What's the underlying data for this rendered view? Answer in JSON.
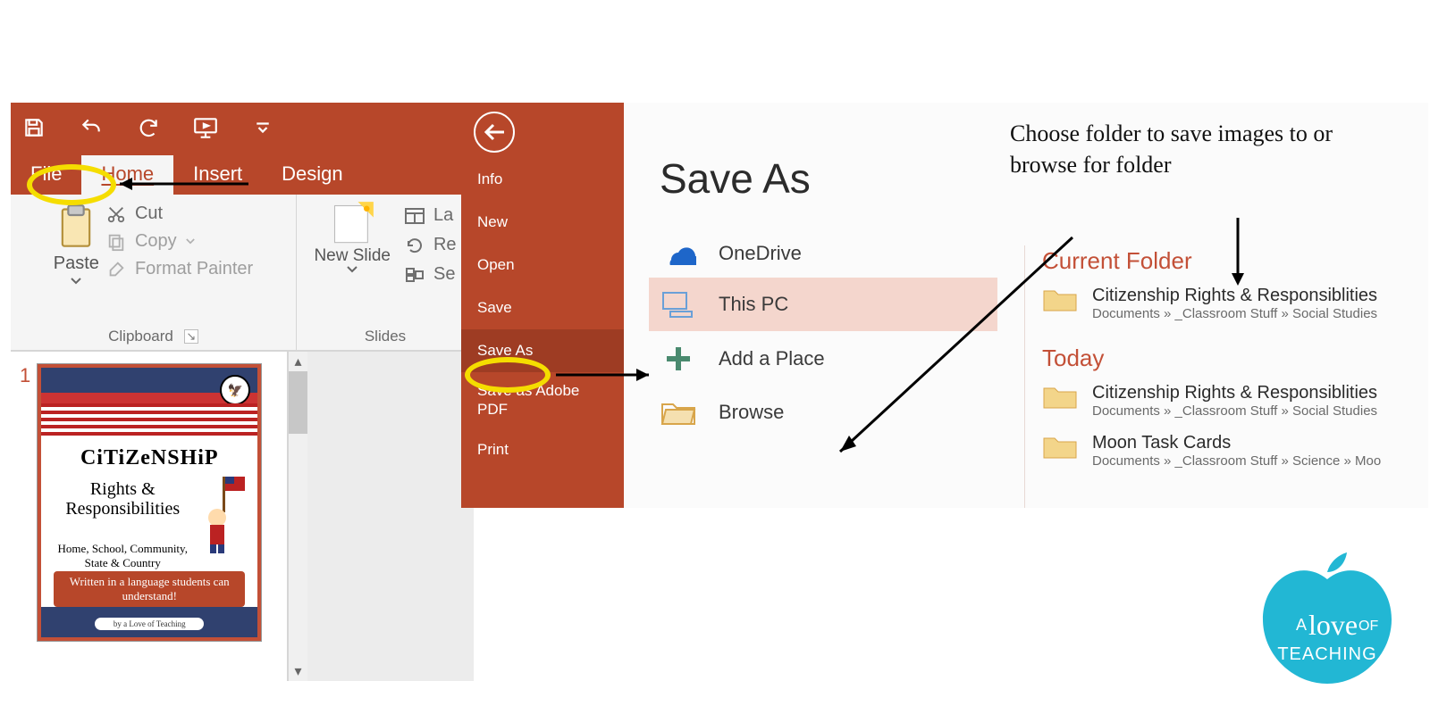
{
  "quick_access": {
    "save_tooltip": "Save",
    "undo_tooltip": "Undo",
    "redo_tooltip": "Redo",
    "start_show_tooltip": "Start From Beginning",
    "customize_tooltip": "Customize"
  },
  "tabs": {
    "file": "File",
    "home": "Home",
    "insert": "Insert",
    "design": "Design"
  },
  "ribbon": {
    "clipboard": {
      "paste": "Paste",
      "cut": "Cut",
      "copy": "Copy",
      "format_painter": "Format Painter",
      "group_label": "Clipboard"
    },
    "slides": {
      "new_slide": "New Slide",
      "layout_trunc": "La",
      "reset_trunc": "Re",
      "section_trunc": "Se",
      "group_label": "Slides"
    }
  },
  "slide_thumb": {
    "number": "1",
    "title": "CiTiZeNSHiP",
    "subtitle": "Rights & Responsibilities",
    "scope": "Home, School, Community, State & Country",
    "blurb": "Written in a language students can understand!",
    "credit": "by a Love of Teaching"
  },
  "backstage": {
    "info": "Info",
    "new": "New",
    "open": "Open",
    "save": "Save",
    "save_as": "Save As",
    "save_adobe": "Save as Adobe PDF",
    "print": "Print"
  },
  "saveas": {
    "heading": "Save As",
    "locations": {
      "onedrive": "OneDrive",
      "this_pc": "This PC",
      "add_place": "Add a Place",
      "browse": "Browse"
    },
    "current_folder_head": "Current Folder",
    "today_head": "Today",
    "folders": [
      {
        "name": "Citizenship Rights & Responsiblities",
        "path": "Documents » _Classroom Stuff » Social Studies"
      },
      {
        "name": "Citizenship Rights & Responsiblities",
        "path": "Documents » _Classroom Stuff » Social Studies"
      },
      {
        "name": "Moon Task Cards",
        "path": "Documents » _Classroom Stuff » Science » Moo"
      }
    ]
  },
  "annotation": {
    "text": "Choose folder to save images to or browse for folder"
  },
  "watermark": {
    "line1": "A",
    "line2": "love",
    "line3": "OF",
    "line4": "TEACHING"
  }
}
